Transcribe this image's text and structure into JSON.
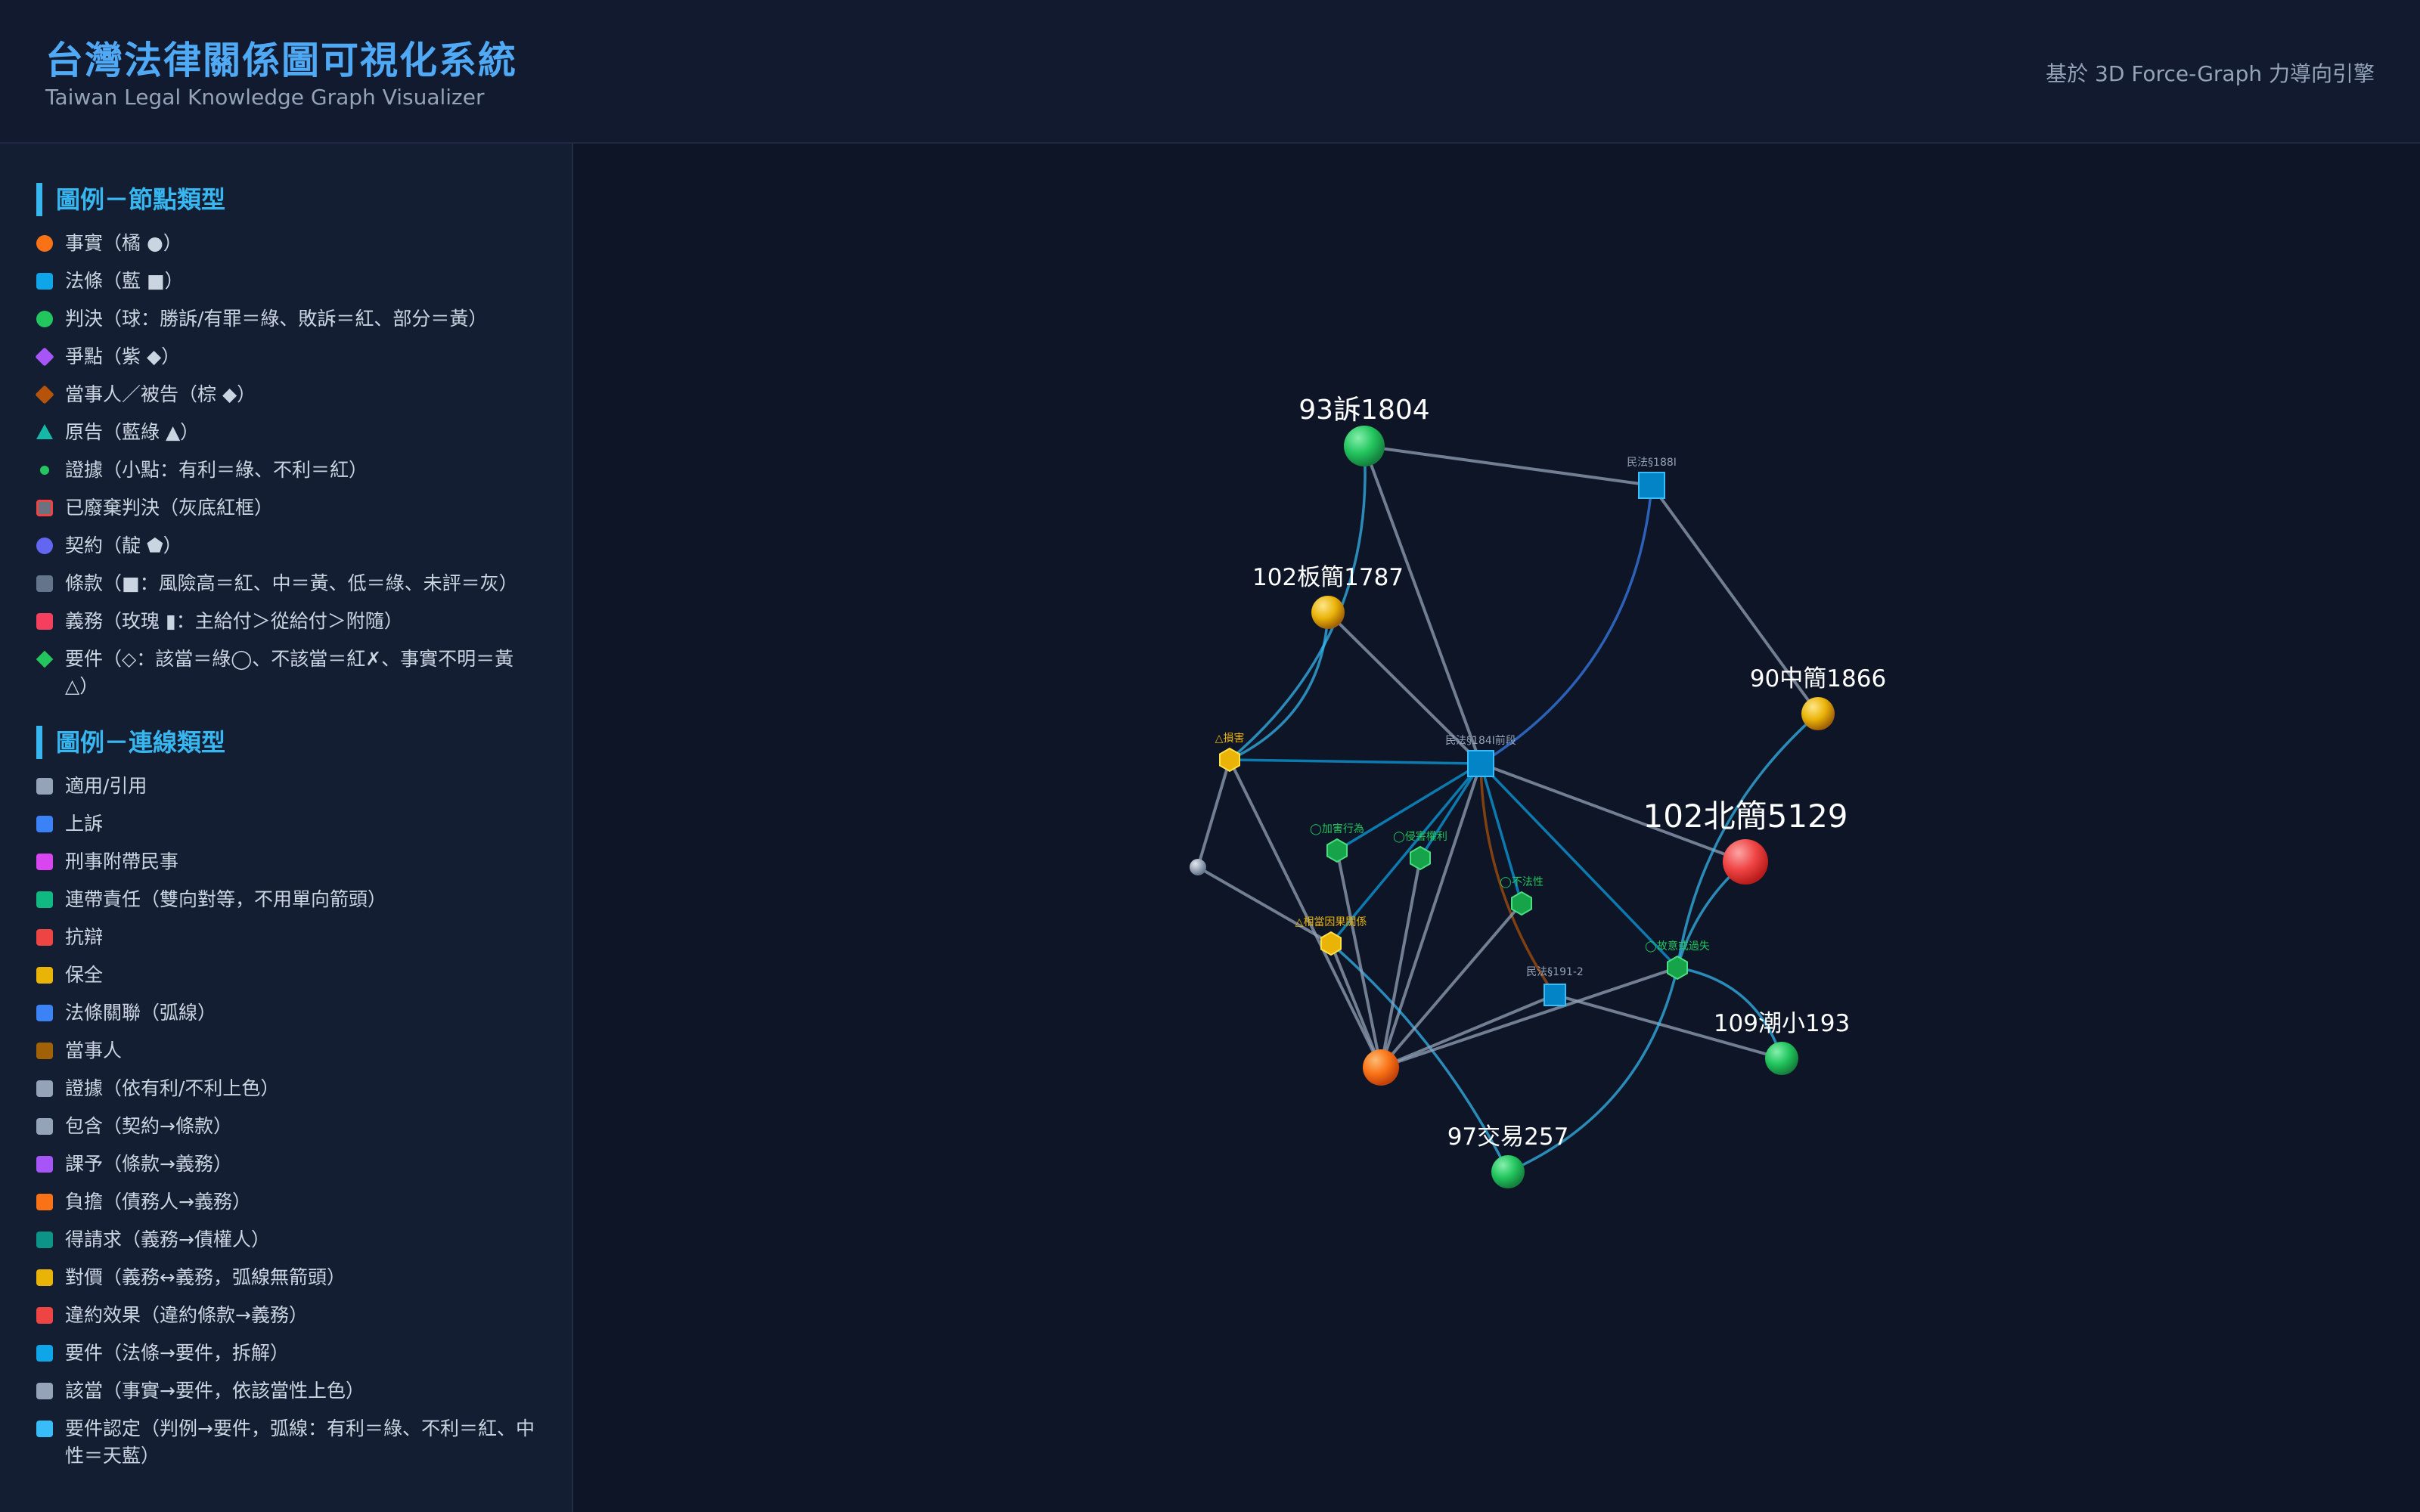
{
  "header": {
    "title": "台灣法律關係圖可視化系統",
    "subtitle": "Taiwan Legal Knowledge Graph Visualizer",
    "engine_note": "基於 3D Force-Graph 力導向引擎"
  },
  "legend_nodes": {
    "title": "圖例－節點類型",
    "items": [
      {
        "label": "事實（橘 ●）",
        "shape": "circle",
        "color": "#f97316"
      },
      {
        "label": "法條（藍 ■）",
        "shape": "square",
        "color": "#0ea5e9"
      },
      {
        "label": "判決（球：勝訴/有罪＝綠、敗訴＝紅、部分＝黃）",
        "shape": "circle",
        "color": "#22c55e"
      },
      {
        "label": "爭點（紫 ◆）",
        "shape": "diamond",
        "color": "#a855f7"
      },
      {
        "label": "當事人／被告（棕 ◆）",
        "shape": "diamond",
        "color": "#b45309"
      },
      {
        "label": "原告（藍綠 ▲）",
        "shape": "triangle",
        "color": "#14b8a6"
      },
      {
        "label": "證據（小點：有利＝綠、不利＝紅）",
        "shape": "dot",
        "color": "#22c55e"
      },
      {
        "label": "已廢棄判決（灰底紅框）",
        "shape": "abandoned",
        "color": "#6b7280"
      },
      {
        "label": "契約（靛 ⬟）",
        "shape": "circle",
        "color": "#6366f1"
      },
      {
        "label": "條款（■：風險高＝紅、中＝黃、低＝綠、未評＝灰）",
        "shape": "square",
        "color": "#64748b"
      },
      {
        "label": "義務（玫瑰 ▮：主給付＞從給付＞附隨）",
        "shape": "square",
        "color": "#f43f5e"
      },
      {
        "label": "要件（◇：該當＝綠◯、不該當＝紅✗、事實不明＝黃△）",
        "shape": "small-diamond",
        "color": "#22c55e"
      }
    ]
  },
  "legend_links": {
    "title": "圖例－連線類型",
    "items": [
      {
        "label": "適用/引用",
        "color": "#94a3b8"
      },
      {
        "label": "上訴",
        "color": "#3b82f6"
      },
      {
        "label": "刑事附帶民事",
        "color": "#d946ef"
      },
      {
        "label": "連帶責任（雙向對等，不用單向箭頭）",
        "color": "#10b981"
      },
      {
        "label": "抗辯",
        "color": "#ef4444"
      },
      {
        "label": "保全",
        "color": "#eab308"
      },
      {
        "label": "法條關聯（弧線）",
        "color": "#3b82f6"
      },
      {
        "label": "當事人",
        "color": "#a16207"
      },
      {
        "label": "證據（依有利/不利上色）",
        "color": "#94a3b8"
      },
      {
        "label": "包含（契約→條款）",
        "color": "#94a3b8"
      },
      {
        "label": "課予（條款→義務）",
        "color": "#a855f7"
      },
      {
        "label": "負擔（債務人→義務）",
        "color": "#f97316"
      },
      {
        "label": "得請求（義務→債權人）",
        "color": "#0d9488"
      },
      {
        "label": "對價（義務↔義務，弧線無箭頭）",
        "color": "#eab308"
      },
      {
        "label": "違約效果（違約條款→義務）",
        "color": "#ef4444"
      },
      {
        "label": "要件（法條→要件，拆解）",
        "color": "#0ea5e9"
      },
      {
        "label": "該當（事實→要件，依該當性上色）",
        "color": "#94a3b8"
      },
      {
        "label": "要件認定（判例→要件，弧線：有利＝綠、不利＝紅、中性＝天藍）",
        "color": "#38bdf8"
      }
    ]
  },
  "graph": {
    "nodes": [
      {
        "id": "n93",
        "name": "judgment-node",
        "label": "93訴1804",
        "type": "judgment",
        "color": "#22c55e"
      },
      {
        "id": "n102b",
        "name": "judgment-node",
        "label": "102板簡1787",
        "type": "judgment",
        "color": "#eab308"
      },
      {
        "id": "n90",
        "name": "judgment-node",
        "label": "90中簡1866",
        "type": "judgment",
        "color": "#eab308"
      },
      {
        "id": "n102n",
        "name": "judgment-node",
        "label": "102北簡5129",
        "type": "judgment",
        "color": "#ef4444"
      },
      {
        "id": "n109",
        "name": "judgment-node",
        "label": "109潮小193",
        "type": "judgment",
        "color": "#22c55e"
      },
      {
        "id": "n97",
        "name": "judgment-node",
        "label": "97交易257",
        "type": "judgment",
        "color": "#22c55e"
      },
      {
        "id": "s188",
        "name": "statute-node",
        "label": "民法§188Ⅰ",
        "type": "statute",
        "color": "#0ea5e9"
      },
      {
        "id": "s184",
        "name": "statute-node",
        "label": "民法§184Ⅰ前段",
        "type": "statute",
        "color": "#0ea5e9"
      },
      {
        "id": "s191",
        "name": "statute-node",
        "label": "民法§191-2",
        "type": "statute",
        "color": "#0ea5e9"
      },
      {
        "id": "fact",
        "name": "fact-node",
        "label": "",
        "type": "fact",
        "color": "#f97316"
      },
      {
        "id": "gray",
        "name": "unknown-node",
        "label": "",
        "type": "other",
        "color": "#94a3b8"
      },
      {
        "id": "e1",
        "name": "element-node",
        "label": "△損害",
        "type": "element",
        "color": "#eab308"
      },
      {
        "id": "e2",
        "name": "element-node",
        "label": "◯加害行為",
        "type": "element",
        "color": "#22c55e"
      },
      {
        "id": "e3",
        "name": "element-node",
        "label": "◯侵害權利",
        "type": "element",
        "color": "#22c55e"
      },
      {
        "id": "e4",
        "name": "element-node",
        "label": "◯不法性",
        "type": "element",
        "color": "#22c55e"
      },
      {
        "id": "e5",
        "name": "element-node",
        "label": "△相當因果關係",
        "type": "element",
        "color": "#eab308"
      },
      {
        "id": "e6",
        "name": "element-node",
        "label": "◯故意或過失",
        "type": "element",
        "color": "#22c55e"
      }
    ],
    "links": [
      {
        "source": "n93",
        "target": "s188",
        "kind": "apply",
        "color": "#94a3b8"
      },
      {
        "source": "n93",
        "target": "s184",
        "kind": "apply",
        "color": "#94a3b8"
      },
      {
        "source": "n93",
        "target": "e1",
        "kind": "element-finding",
        "color": "#38bdf8"
      },
      {
        "source": "s188",
        "target": "s184",
        "kind": "statute-relation",
        "color": "#3b82f6"
      },
      {
        "source": "s188",
        "target": "n90",
        "kind": "apply",
        "color": "#94a3b8"
      },
      {
        "source": "n102b",
        "target": "s184",
        "kind": "apply",
        "color": "#94a3b8"
      },
      {
        "source": "n102b",
        "target": "e1",
        "kind": "element-finding",
        "color": "#38bdf8"
      },
      {
        "source": "s184",
        "target": "e1",
        "kind": "element",
        "color": "#0ea5e9"
      },
      {
        "source": "s184",
        "target": "e2",
        "kind": "element",
        "color": "#0ea5e9"
      },
      {
        "source": "s184",
        "target": "e3",
        "kind": "element",
        "color": "#0ea5e9"
      },
      {
        "source": "s184",
        "target": "e4",
        "kind": "element",
        "color": "#0ea5e9"
      },
      {
        "source": "s184",
        "target": "e5",
        "kind": "element",
        "color": "#0ea5e9"
      },
      {
        "source": "s184",
        "target": "e6",
        "kind": "element",
        "color": "#0ea5e9"
      },
      {
        "source": "s184",
        "target": "n102n",
        "kind": "apply",
        "color": "#94a3b8"
      },
      {
        "source": "s184",
        "target": "s191",
        "kind": "statute-relation",
        "color": "#b45309"
      },
      {
        "source": "s184",
        "target": "fact",
        "kind": "apply",
        "color": "#94a3b8"
      },
      {
        "source": "n90",
        "target": "e6",
        "kind": "element-finding",
        "color": "#38bdf8"
      },
      {
        "source": "n102n",
        "target": "e6",
        "kind": "element-finding",
        "color": "#38bdf8"
      },
      {
        "source": "s191",
        "target": "n109",
        "kind": "apply",
        "color": "#94a3b8"
      },
      {
        "source": "e6",
        "target": "n109",
        "kind": "element-finding",
        "color": "#38bdf8"
      },
      {
        "source": "e6",
        "target": "n97",
        "kind": "element-finding",
        "color": "#38bdf8"
      },
      {
        "source": "e5",
        "target": "n97",
        "kind": "element-finding",
        "color": "#38bdf8"
      },
      {
        "source": "gray",
        "target": "e1",
        "kind": "apply",
        "color": "#94a3b8"
      },
      {
        "source": "gray",
        "target": "e5",
        "kind": "apply",
        "color": "#94a3b8"
      },
      {
        "source": "fact",
        "target": "e1",
        "kind": "fulfil",
        "color": "#94a3b8"
      },
      {
        "source": "fact",
        "target": "e2",
        "kind": "fulfil",
        "color": "#94a3b8"
      },
      {
        "source": "fact",
        "target": "e3",
        "kind": "fulfil",
        "color": "#94a3b8"
      },
      {
        "source": "fact",
        "target": "e4",
        "kind": "fulfil",
        "color": "#94a3b8"
      },
      {
        "source": "fact",
        "target": "e5",
        "kind": "fulfil",
        "color": "#94a3b8"
      },
      {
        "source": "fact",
        "target": "e6",
        "kind": "fulfil",
        "color": "#94a3b8"
      },
      {
        "source": "fact",
        "target": "s191",
        "kind": "apply",
        "color": "#94a3b8"
      }
    ]
  }
}
